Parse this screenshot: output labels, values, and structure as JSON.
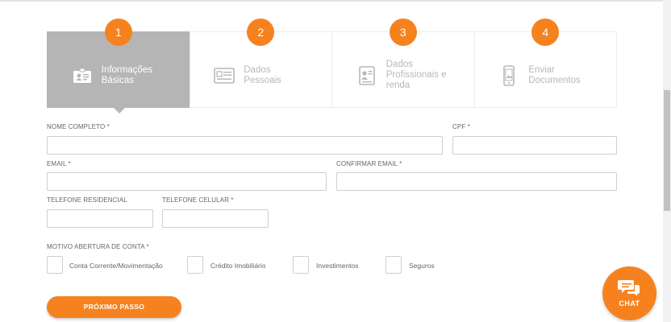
{
  "steps": [
    {
      "number": "1",
      "label": "Informações Básicas",
      "icon": "id-card-icon",
      "active": true
    },
    {
      "number": "2",
      "label": "Dados Pessoais",
      "icon": "form-document-icon",
      "active": false
    },
    {
      "number": "3",
      "label": "Dados Profissionais e renda",
      "icon": "professional-badge-icon",
      "active": false
    },
    {
      "number": "4",
      "label": "Enviar Documentos",
      "icon": "mobile-phone-icon",
      "active": false
    }
  ],
  "form": {
    "nome_label": "NOME COMPLETO *",
    "cpf_label": "CPF *",
    "email_label": "EMAIL *",
    "confirm_email_label": "CONFIRMAR EMAIL *",
    "tel_res_label": "TELEFONE RESIDENCIAL",
    "tel_cel_label": "TELEFONE CELULAR *",
    "motivo_label": "MOTIVO ABERTURA DE CONTA *",
    "options": [
      "Conta Corrente/Movimentação",
      "Crédito Imobiliário",
      "Investimentos",
      "Seguros"
    ]
  },
  "next_button": "PRÓXIMO PASSO",
  "chat_label": "CHAT",
  "colors": {
    "accent": "#f6821f",
    "active_step": "#b5b5b5",
    "border": "#cfcfcf"
  }
}
